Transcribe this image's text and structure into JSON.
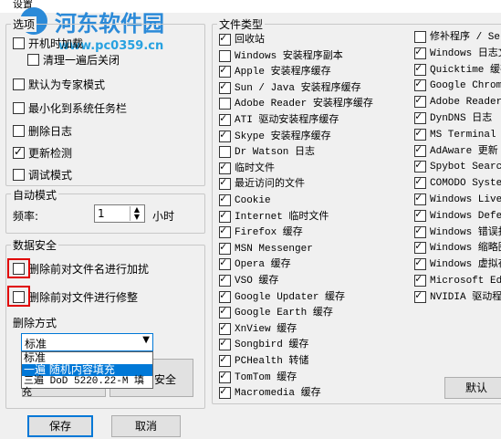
{
  "window": {
    "title": "设置"
  },
  "watermark": {
    "line1": "河东软件园",
    "line2": "www.pc0359.cn"
  },
  "options": {
    "group_title": "选项",
    "items": [
      {
        "label": "开机时加载",
        "checked": false
      },
      {
        "label": "清理一遍后关闭",
        "checked": false
      },
      {
        "label": "默认为专家模式",
        "checked": false
      },
      {
        "label": "最小化到系统任务栏",
        "checked": false
      },
      {
        "label": "删除日志",
        "checked": false
      },
      {
        "label": "更新检测",
        "checked": true
      },
      {
        "label": "调试模式",
        "checked": false
      }
    ]
  },
  "auto": {
    "group_title": "自动模式",
    "freq_label": "频率:",
    "freq_value": "1",
    "unit": "小时"
  },
  "security": {
    "group_title": "数据安全",
    "items": [
      {
        "label": "删除前对文件名进行加扰",
        "checked": false
      },
      {
        "label": "删除前对文件进行修整",
        "checked": false
      }
    ],
    "method_label": "删除方式",
    "method_selected": "标准",
    "method_options": [
      "标准",
      "一遍 随机内容填充",
      "三遍 DoD 5220.22-M 填充"
    ],
    "partial_button": "安全"
  },
  "filetypes": {
    "group_title": "文件类型",
    "col1": [
      {
        "label": "回收站",
        "checked": true
      },
      {
        "label": "Windows 安装程序副本",
        "checked": false
      },
      {
        "label": "Apple 安装程序缓存",
        "checked": true
      },
      {
        "label": "Sun / Java 安装程序缓存",
        "checked": true
      },
      {
        "label": "Adobe Reader 安装程序缓存",
        "checked": false
      },
      {
        "label": "ATI 驱动安装程序缓存",
        "checked": true
      },
      {
        "label": "Skype 安装程序缓存",
        "checked": true
      },
      {
        "label": "Dr Watson 日志",
        "checked": false
      },
      {
        "label": "临时文件",
        "checked": true
      },
      {
        "label": "最近访问的文件",
        "checked": true
      },
      {
        "label": "Cookie",
        "checked": true
      },
      {
        "label": "Internet 临时文件",
        "checked": true
      },
      {
        "label": "Firefox 缓存",
        "checked": true
      },
      {
        "label": "MSN Messenger",
        "checked": true
      },
      {
        "label": "Opera 缓存",
        "checked": true
      },
      {
        "label": "VSO 缓存",
        "checked": true
      },
      {
        "label": "Google Updater 缓存",
        "checked": true
      },
      {
        "label": "Google Earth 缓存",
        "checked": true
      },
      {
        "label": "XnView 缓存",
        "checked": true
      },
      {
        "label": "Songbird 缓存",
        "checked": true
      },
      {
        "label": "PCHealth 转储",
        "checked": true
      },
      {
        "label": "TomTom 缓存",
        "checked": true
      },
      {
        "label": "Macromedia 缓存",
        "checked": true
      }
    ],
    "col2": [
      {
        "label": "修补程序 / Se",
        "checked": false
      },
      {
        "label": "Windows 日志文",
        "checked": true
      },
      {
        "label": "Quicktime 缓存",
        "checked": true
      },
      {
        "label": "Google Chrome",
        "checked": true
      },
      {
        "label": "Adobe Reader",
        "checked": true
      },
      {
        "label": "DynDNS 日志",
        "checked": true
      },
      {
        "label": "MS Terminal",
        "checked": true
      },
      {
        "label": "AdAware 更新",
        "checked": true
      },
      {
        "label": "Spybot Search",
        "checked": true
      },
      {
        "label": "COMODO Syster",
        "checked": true
      },
      {
        "label": "Windows Live",
        "checked": true
      },
      {
        "label": "Windows Defen",
        "checked": true
      },
      {
        "label": "Windows 错误报",
        "checked": true
      },
      {
        "label": "Windows 缩略图",
        "checked": true
      },
      {
        "label": "Windows 虚拟存",
        "checked": true
      },
      {
        "label": "Microsoft Edg",
        "checked": true
      },
      {
        "label": "NVIDIA 驱动程",
        "checked": true
      }
    ],
    "default_button": "默认"
  },
  "footer": {
    "save": "保存",
    "cancel": "取消"
  }
}
